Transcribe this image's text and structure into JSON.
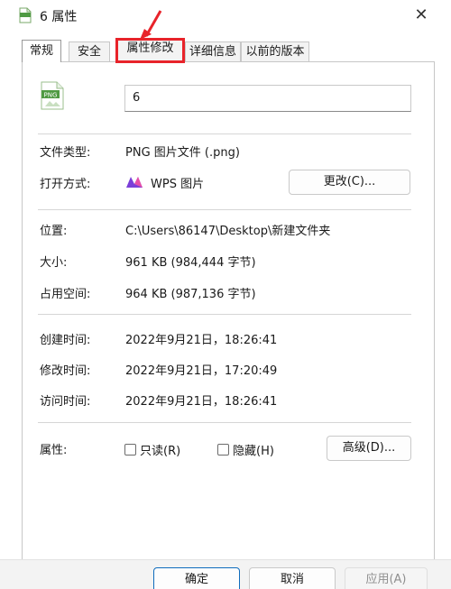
{
  "window": {
    "title": "6 属性",
    "close_symbol": "✕"
  },
  "tabs": [
    {
      "label": "常规",
      "active": true
    },
    {
      "label": "安全",
      "active": false
    },
    {
      "label": "属性修改",
      "active": false,
      "highlighted": true
    },
    {
      "label": "详细信息",
      "active": false
    },
    {
      "label": "以前的版本",
      "active": false
    }
  ],
  "file": {
    "icon": "png-file-icon",
    "icon_text": "PNG",
    "name": "6"
  },
  "general": {
    "type_label": "文件类型:",
    "type_value": "PNG 图片文件 (.png)",
    "open_with_label": "打开方式:",
    "open_with_value": "WPS 图片",
    "open_with_icon": "wps-picture-icon",
    "change_button": "更改(C)...",
    "location_label": "位置:",
    "location_value": "C:\\Users\\86147\\Desktop\\新建文件夹",
    "size_label": "大小:",
    "size_value": "961 KB (984,444 字节)",
    "disk_size_label": "占用空间:",
    "disk_size_value": "964 KB (987,136 字节)",
    "created_label": "创建时间:",
    "created_value": "2022年9月21日，18:26:41",
    "modified_label": "修改时间:",
    "modified_value": "2022年9月21日，17:20:49",
    "accessed_label": "访问时间:",
    "accessed_value": "2022年9月21日，18:26:41",
    "attributes_label": "属性:",
    "readonly_label": "只读(R)",
    "readonly_checked": false,
    "hidden_label": "隐藏(H)",
    "hidden_checked": false,
    "advanced_button": "高级(D)..."
  },
  "footer": {
    "ok_button": "确定",
    "cancel_button": "取消",
    "apply_button": "应用(A)"
  },
  "colors": {
    "highlight": "#e8232a",
    "accent": "#0f6cbd"
  }
}
